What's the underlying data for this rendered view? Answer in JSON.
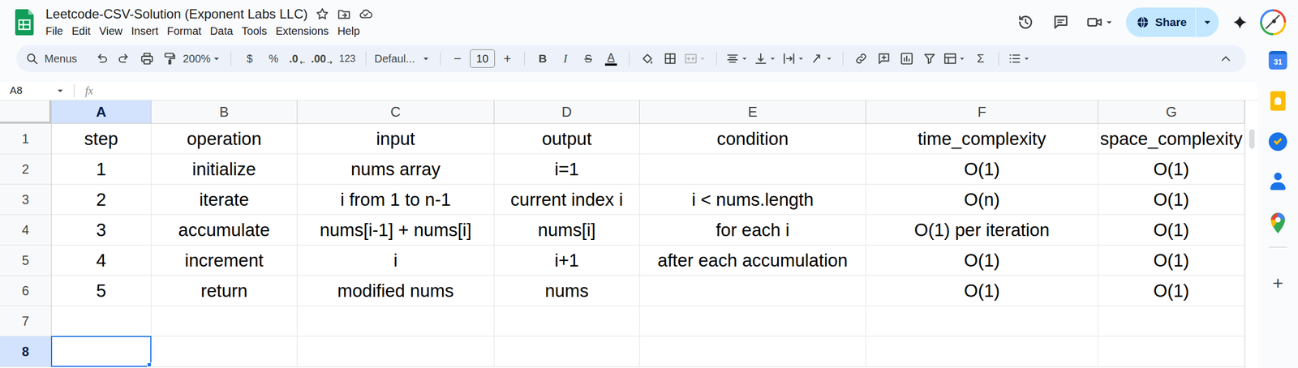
{
  "window": {
    "title": "Leetcode-CSV-Solution (Exponent Labs LLC)"
  },
  "menus": [
    "File",
    "Edit",
    "View",
    "Insert",
    "Format",
    "Data",
    "Tools",
    "Extensions",
    "Help"
  ],
  "header": {
    "share": "Share"
  },
  "toolbar": {
    "search": "Menus",
    "zoom": "200%",
    "currency": "$",
    "percent": "%",
    "decrease_decimals": ".0",
    "increase_decimals": ".00",
    "number_format": "123",
    "font": "Defaul...",
    "size_down": "−",
    "font_size": "10",
    "size_up": "+",
    "bold": "B",
    "italic": "I",
    "strikethrough": "S",
    "text_color": "A",
    "functions": "Σ"
  },
  "formula_bar": {
    "name_box": "A8",
    "fx": "fx",
    "content": ""
  },
  "sheet": {
    "columns": [
      {
        "label": "A",
        "selected": true
      },
      {
        "label": "B",
        "selected": false
      },
      {
        "label": "C",
        "selected": false
      },
      {
        "label": "D",
        "selected": false
      },
      {
        "label": "E",
        "selected": false
      },
      {
        "label": "F",
        "selected": false
      },
      {
        "label": "G",
        "selected": false
      }
    ],
    "rows": [
      {
        "label": "1",
        "selected": false,
        "cells": [
          "step",
          "operation",
          "input",
          "output",
          "condition",
          "time_complexity",
          "space_complexity"
        ]
      },
      {
        "label": "2",
        "selected": false,
        "cells": [
          "1",
          "initialize",
          "nums array",
          "i=1",
          "",
          "O(1)",
          "O(1)"
        ]
      },
      {
        "label": "3",
        "selected": false,
        "cells": [
          "2",
          "iterate",
          "i from 1 to n-1",
          "current index i",
          "i < nums.length",
          "O(n)",
          "O(1)"
        ]
      },
      {
        "label": "4",
        "selected": false,
        "cells": [
          "3",
          "accumulate",
          "nums[i-1] + nums[i]",
          "nums[i]",
          "for each i",
          "O(1) per iteration",
          "O(1)"
        ]
      },
      {
        "label": "5",
        "selected": false,
        "cells": [
          "4",
          "increment",
          "i",
          "i+1",
          "after each accumulation",
          "O(1)",
          "O(1)"
        ]
      },
      {
        "label": "6",
        "selected": false,
        "cells": [
          "5",
          "return",
          "modified nums",
          "nums",
          "",
          "O(1)",
          "O(1)"
        ]
      },
      {
        "label": "7",
        "selected": false,
        "cells": [
          "",
          "",
          "",
          "",
          "",
          "",
          ""
        ]
      },
      {
        "label": "8",
        "selected": true,
        "cells": [
          "",
          "",
          "",
          "",
          "",
          "",
          ""
        ]
      }
    ],
    "active_cell": {
      "column": "A",
      "row": "8"
    }
  },
  "sidebar": {
    "calendar": "31",
    "add": "+"
  }
}
